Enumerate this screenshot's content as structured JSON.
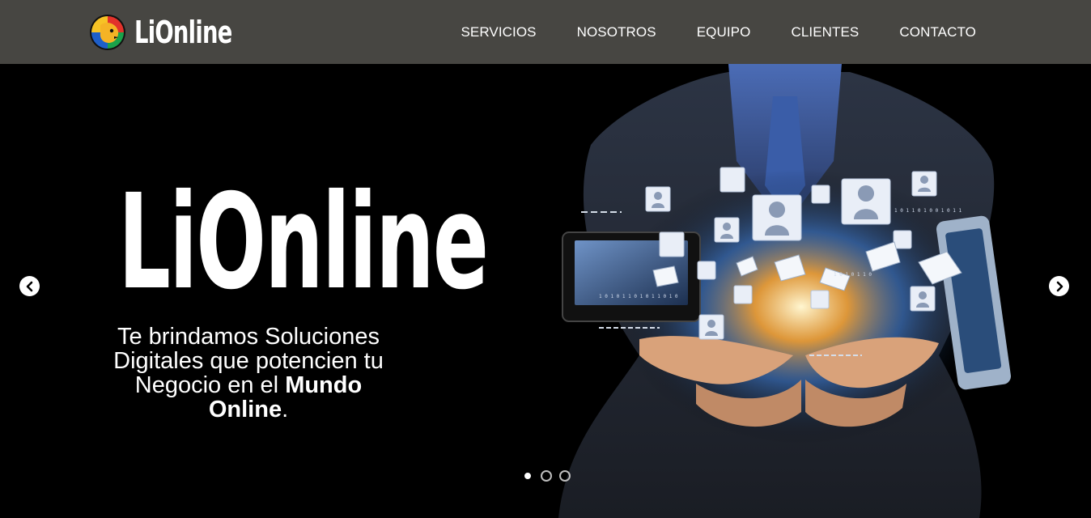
{
  "header": {
    "logo_text": "LiOnline",
    "logo_icon": "lion-head-logo-icon"
  },
  "nav": {
    "items": [
      {
        "label": "SERVICIOS"
      },
      {
        "label": "NOSOTROS"
      },
      {
        "label": "EQUIPO"
      },
      {
        "label": "CLIENTES"
      },
      {
        "label": "CONTACTO"
      }
    ]
  },
  "hero": {
    "brand": "LiOnline",
    "tagline_line1": "Te brindamos Soluciones",
    "tagline_line2": "Digitales que potencien tu",
    "tagline_line3": "Negocio en el ",
    "tagline_bold1": "Mundo",
    "tagline_bold2": "Online",
    "tagline_end": ".",
    "prev_icon": "chevron-left-icon",
    "next_icon": "chevron-right-icon",
    "slides_total": 3,
    "slide_active": 1
  },
  "colors": {
    "header_bg": "#474642",
    "hero_bg": "#000000",
    "text": "#ffffff",
    "glow_orange": "#f2a33a",
    "glow_blue": "#4aa8ff"
  }
}
